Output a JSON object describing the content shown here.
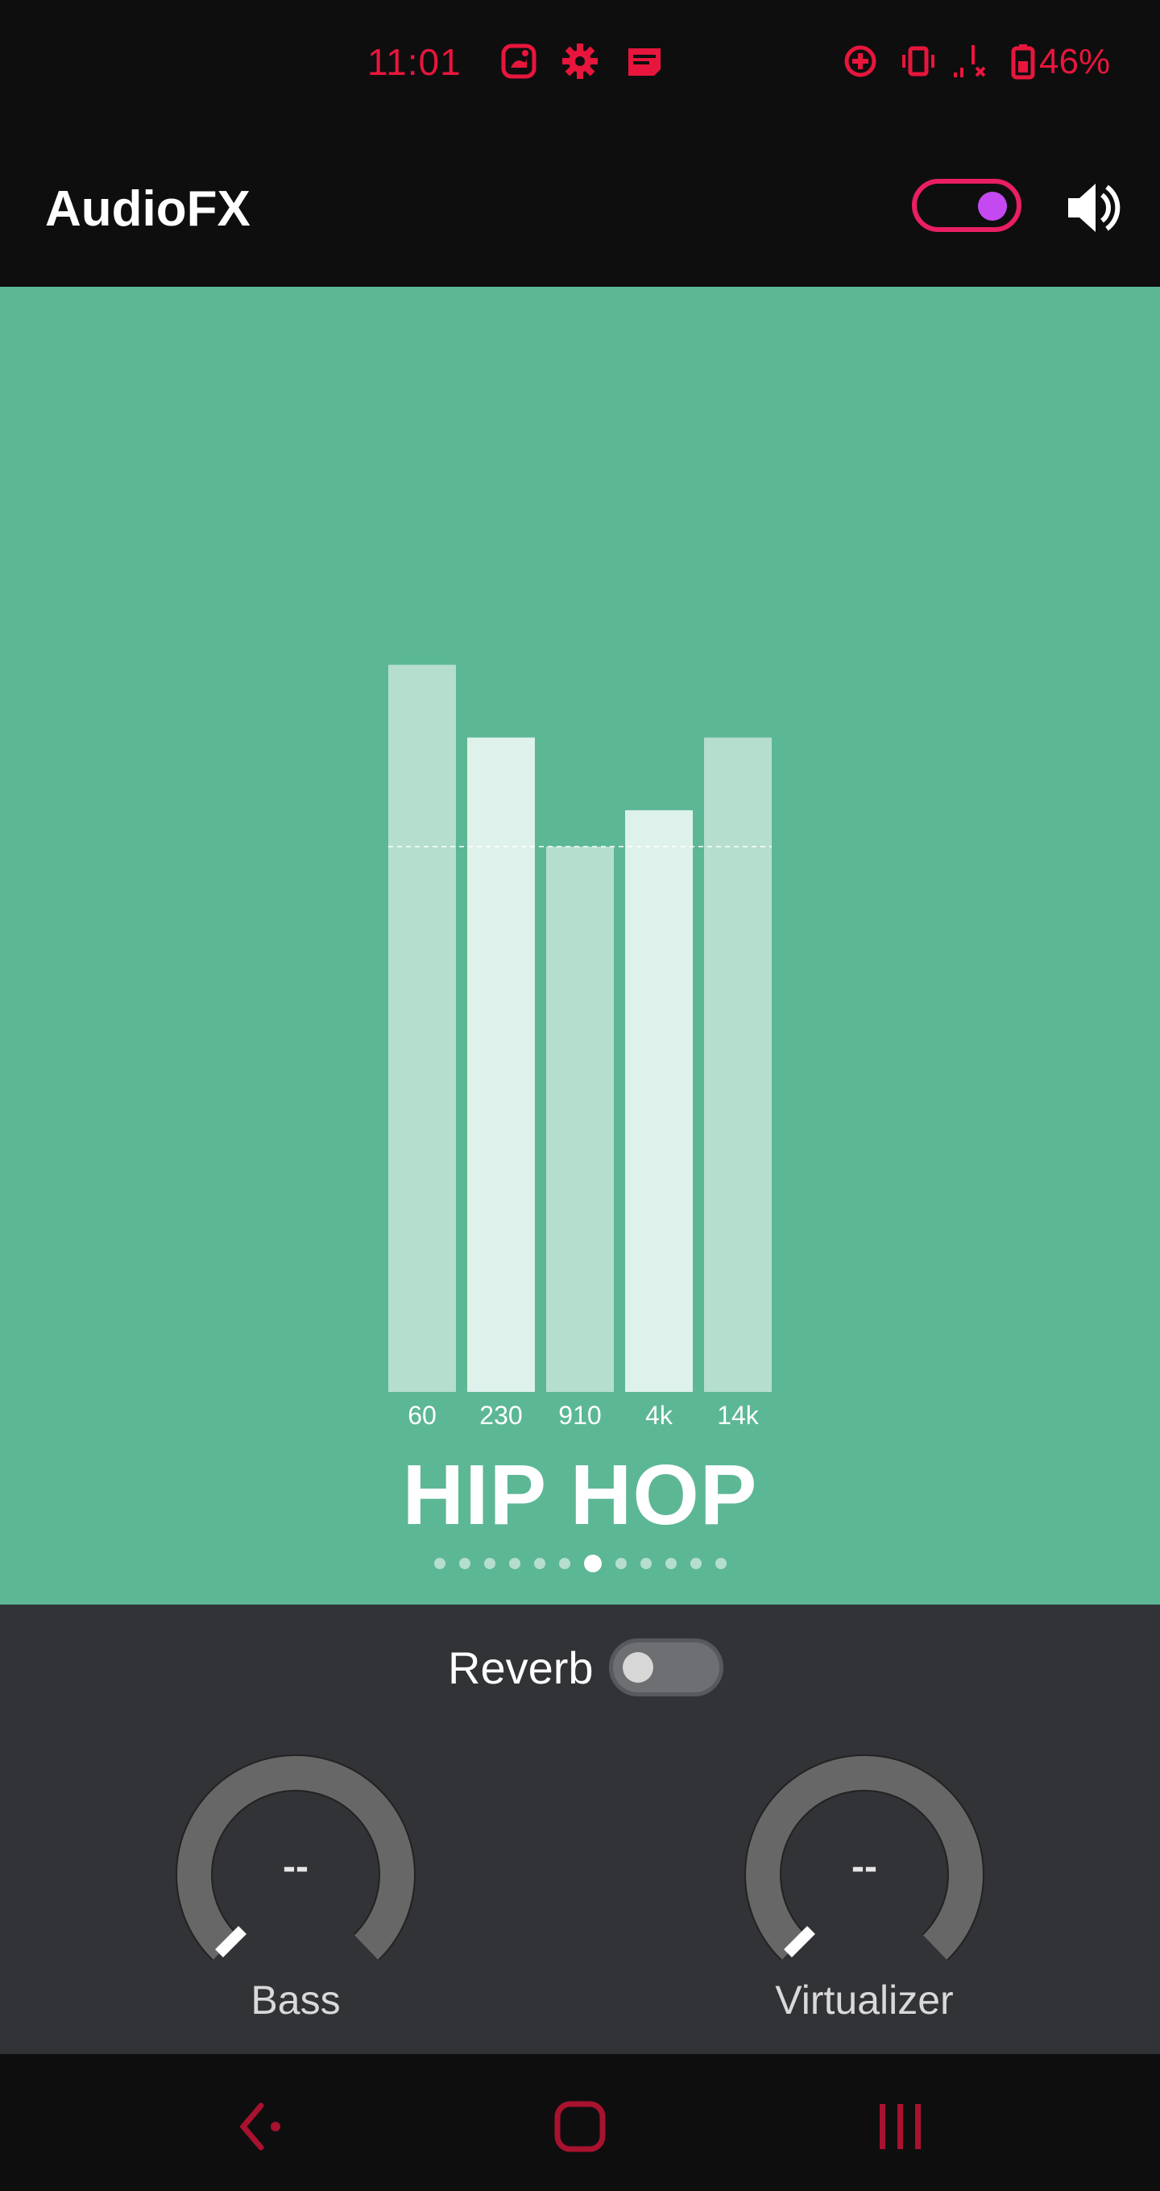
{
  "status_bar": {
    "time": "11:01",
    "left_icons": [
      "gallery-icon",
      "settings-icon",
      "notification-icon"
    ],
    "right_icons": [
      "data-saver-icon",
      "vibrate-icon",
      "no-signal-icon",
      "battery-icon"
    ],
    "battery_percent": "46%",
    "color": "#e8163c"
  },
  "app_bar": {
    "title": "AudioFX",
    "master_switch_on": true,
    "accent_color": "#e91e63",
    "knob_color": "#c549f0",
    "volume_icon": "speaker-icon"
  },
  "equalizer": {
    "background": "#5cb795",
    "preset": "HIP HOP",
    "preset_index": 6,
    "preset_count": 12
  },
  "chart_data": {
    "type": "bar",
    "categories": [
      "60",
      "230",
      "910",
      "4k",
      "14k"
    ],
    "values": [
      5.0,
      3.0,
      0.0,
      1.0,
      3.0
    ],
    "ylim": [
      -15,
      5
    ],
    "zero_line": true,
    "grid": false,
    "xlabel": "",
    "ylabel": ""
  },
  "effects": {
    "reverb_label": "Reverb",
    "reverb_on": false,
    "bass": {
      "label": "Bass",
      "value": "--"
    },
    "virtualizer": {
      "label": "Virtualizer",
      "value": "--"
    }
  },
  "nav_bar": {
    "buttons": [
      "back-icon",
      "home-icon",
      "recents-icon"
    ],
    "color": "#a8122f"
  }
}
